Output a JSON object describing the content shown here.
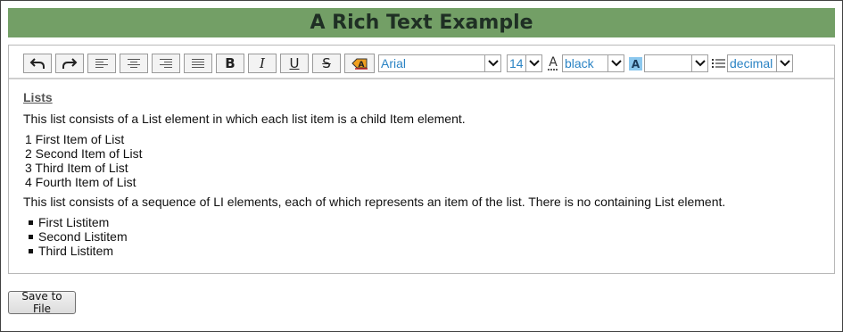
{
  "title": "A Rich Text Example",
  "toolbar": {
    "buttons": {
      "undo": "undo-icon",
      "redo": "redo-icon",
      "align_left": "align-left-icon",
      "align_center": "align-center-icon",
      "align_right": "align-right-icon",
      "justify": "align-justify-icon",
      "bold": "B",
      "italic": "I",
      "underline": "U",
      "strikethrough": "S",
      "clear_format": "clear-format-icon"
    },
    "font_family": "Arial",
    "font_size": "14",
    "text_color": "black",
    "highlight_color": "",
    "list_style": "decimal"
  },
  "document": {
    "heading": "Lists",
    "intro1": "This list consists of a List element in which each list item is a child Item element.",
    "numbered_items": [
      "1 First Item of List",
      "2 Second Item of List",
      "3 Third Item of List",
      "4 Fourth Item of List"
    ],
    "intro2": "This list consists of a sequence of LI elements, each of which represents an item of the list. There is no containing List element.",
    "bullet_items": [
      "First Listitem",
      "Second Listitem",
      "Third Listitem"
    ]
  },
  "save_button": "Save to File",
  "colors": {
    "title_bar": "#739f66",
    "title_text": "#1f2f24",
    "select_text": "#2a83c4"
  }
}
